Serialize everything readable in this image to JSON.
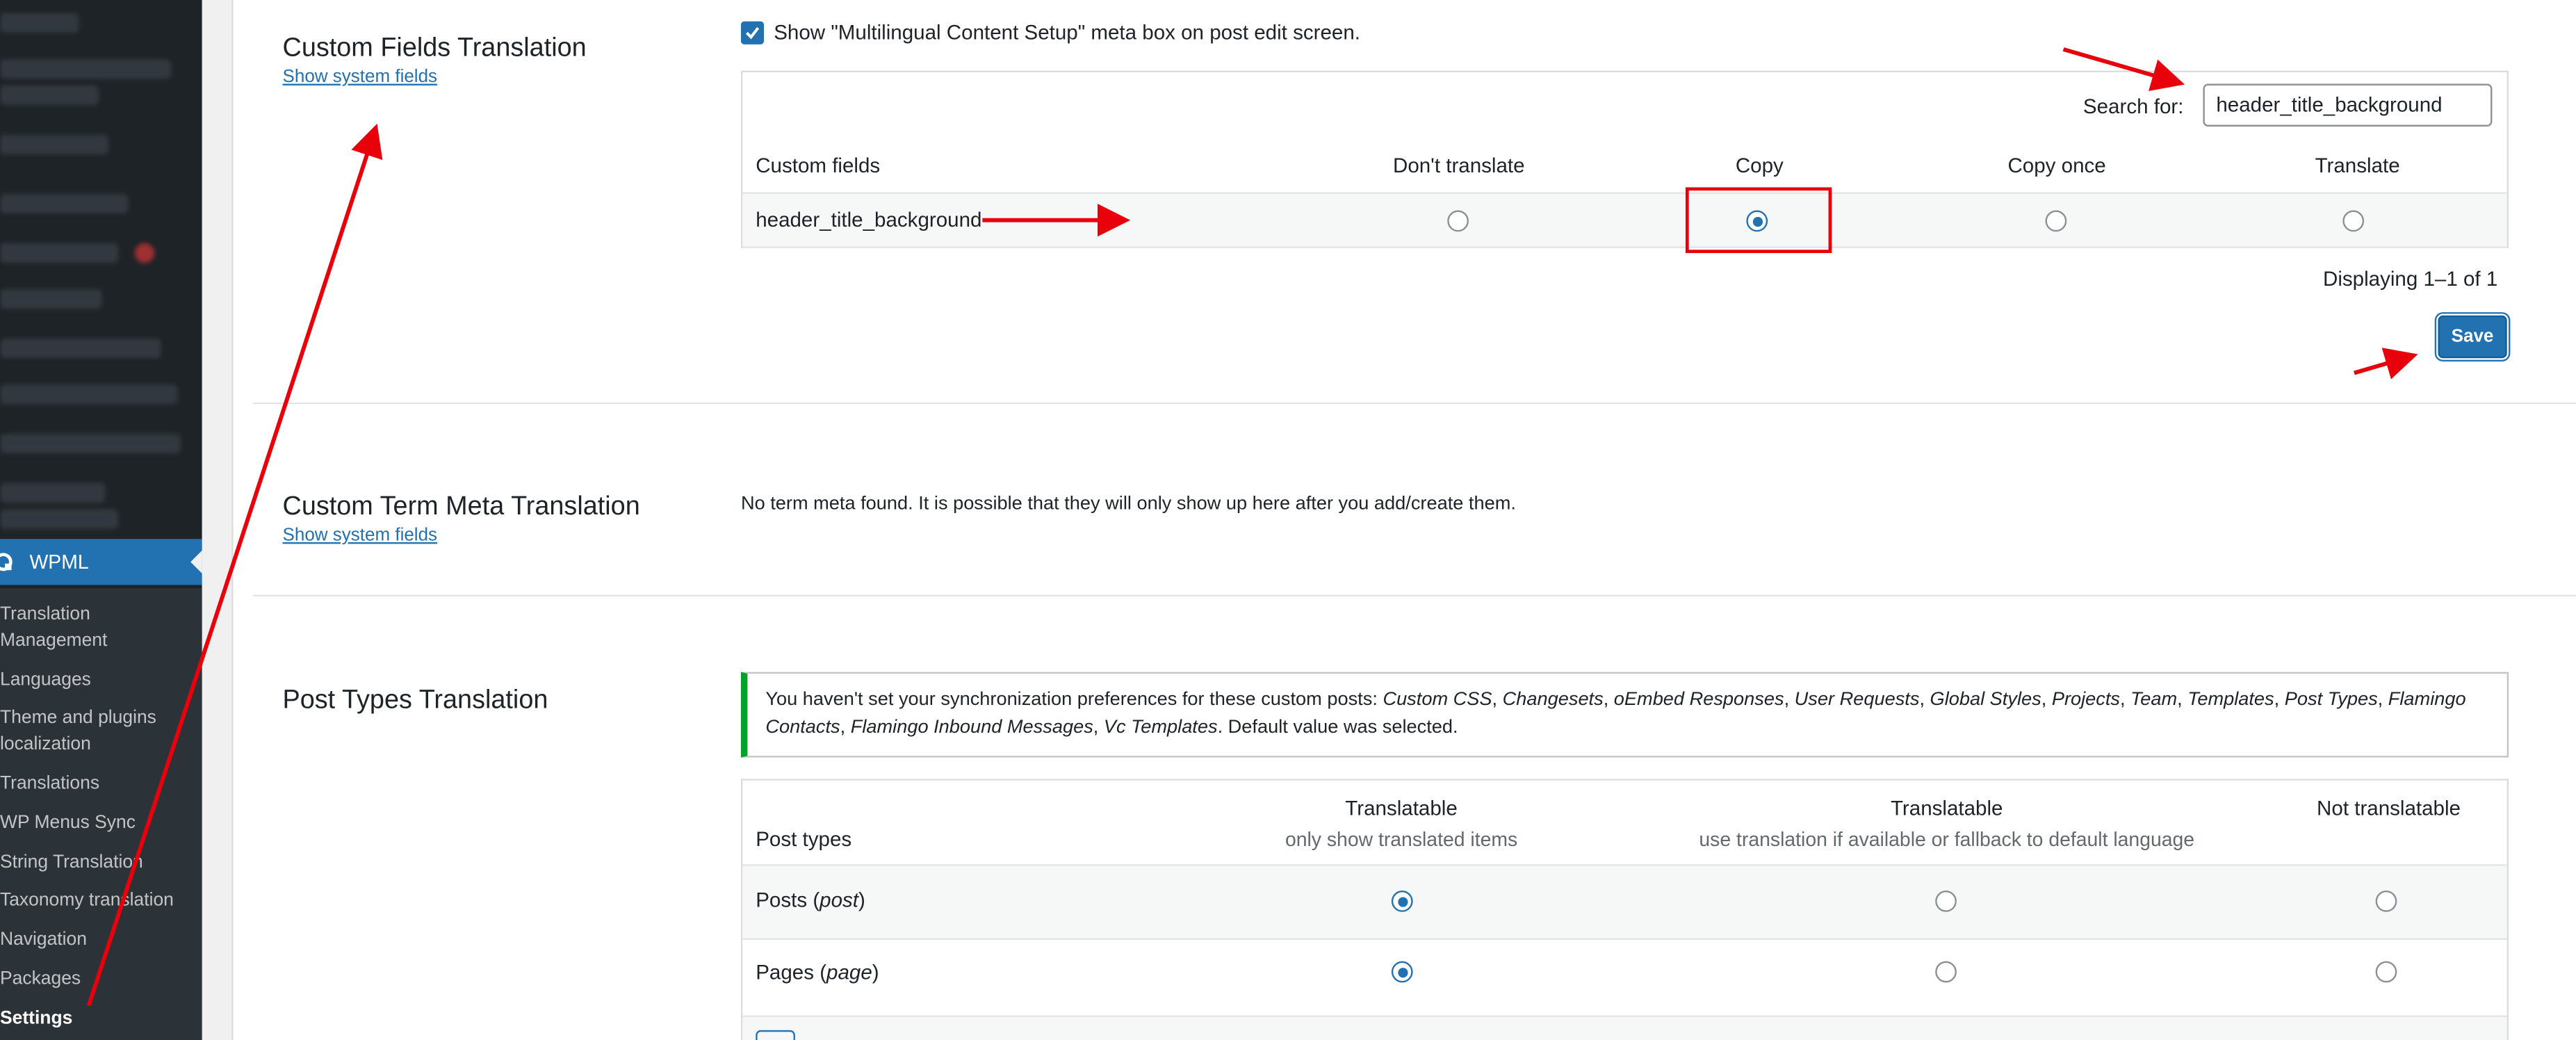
{
  "sidebar": {
    "wpml_label": "WPML",
    "submenu": [
      {
        "line1": "Translation",
        "line2": "Management"
      },
      {
        "line1": "Languages"
      },
      {
        "line1": "Theme and plugins",
        "line2": "localization"
      },
      {
        "line1": "Translations"
      },
      {
        "line1": "WP Menus Sync"
      },
      {
        "line1": "String Translation"
      },
      {
        "line1": "Taxonomy translation"
      },
      {
        "line1": "Navigation"
      },
      {
        "line1": "Packages"
      },
      {
        "line1": "Settings"
      }
    ]
  },
  "custom_fields": {
    "title": "Custom Fields Translation",
    "system_link": "Show system fields",
    "checkbox_label": "Show \"Multilingual Content Setup\" meta box on post edit screen.",
    "checkbox_checked": true,
    "search_label": "Search for:",
    "search_value": "header_title_background",
    "columns": [
      "Custom fields",
      "Don't translate",
      "Copy",
      "Copy once",
      "Translate"
    ],
    "rows": [
      {
        "name": "header_title_background",
        "selected": "Copy"
      }
    ],
    "displaying": "Displaying 1–1 of 1",
    "save_label": "Save"
  },
  "term_meta": {
    "title": "Custom Term Meta Translation",
    "system_link": "Show system fields",
    "message": "No term meta found. It is possible that they will only show up here after you add/create them."
  },
  "post_types": {
    "title": "Post Types Translation",
    "notice_prefix": "You haven't set your synchronization preferences for these custom posts: ",
    "notice_items": [
      "Custom CSS",
      "Changesets",
      "oEmbed Responses",
      "User Requests",
      "Global Styles",
      "Projects",
      "Team",
      "Templates",
      "Post Types",
      "Flamingo Contacts",
      "Flamingo Inbound Messages",
      "Vc Templates"
    ],
    "notice_suffix": ". Default value was selected.",
    "columns": {
      "post_types": "Post types",
      "col1_title": "Translatable",
      "col1_sub": "only show translated items",
      "col2_title": "Translatable",
      "col2_sub": "use translation if available or fallback to default language",
      "col3_title": "Not translatable"
    },
    "rows": [
      {
        "label": "Posts",
        "slug": "post",
        "selected": "col1"
      },
      {
        "label": "Pages",
        "slug": "page",
        "selected": "col1"
      }
    ]
  },
  "colors": {
    "accent": "#2271b1",
    "sidebar_bg": "#1d2327",
    "annotation_red": "#e8000b",
    "notice_green": "#00a32a"
  }
}
